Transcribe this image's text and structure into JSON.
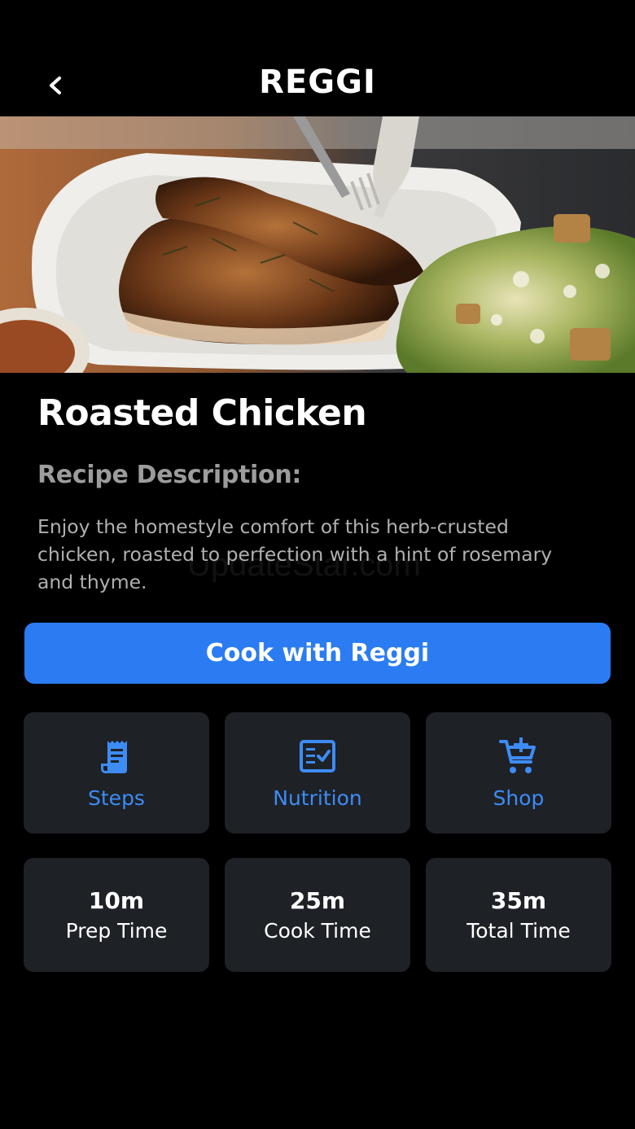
{
  "header": {
    "title": "REGGI",
    "back_icon": "chevron-left-icon"
  },
  "recipe": {
    "title": "Roasted Chicken",
    "description_heading": "Recipe Description:",
    "description": "Enjoy the homestyle comfort of this herb-crusted chicken, roasted to perfection with a hint of rosemary and thyme."
  },
  "watermark": "UpdateStar.com",
  "cook_button": {
    "label": "Cook with Reggi"
  },
  "actions": [
    {
      "label": "Steps",
      "icon": "receipt-icon"
    },
    {
      "label": "Nutrition",
      "icon": "checklist-icon"
    },
    {
      "label": "Shop",
      "icon": "cart-add-icon"
    }
  ],
  "times": [
    {
      "value": "10m",
      "label": "Prep Time"
    },
    {
      "value": "25m",
      "label": "Cook Time"
    },
    {
      "value": "35m",
      "label": "Total Time"
    }
  ],
  "colors": {
    "background": "#000000",
    "accent": "#2b7cf3",
    "tile": "#1e2126",
    "icon_blue": "#3d8cf5"
  }
}
